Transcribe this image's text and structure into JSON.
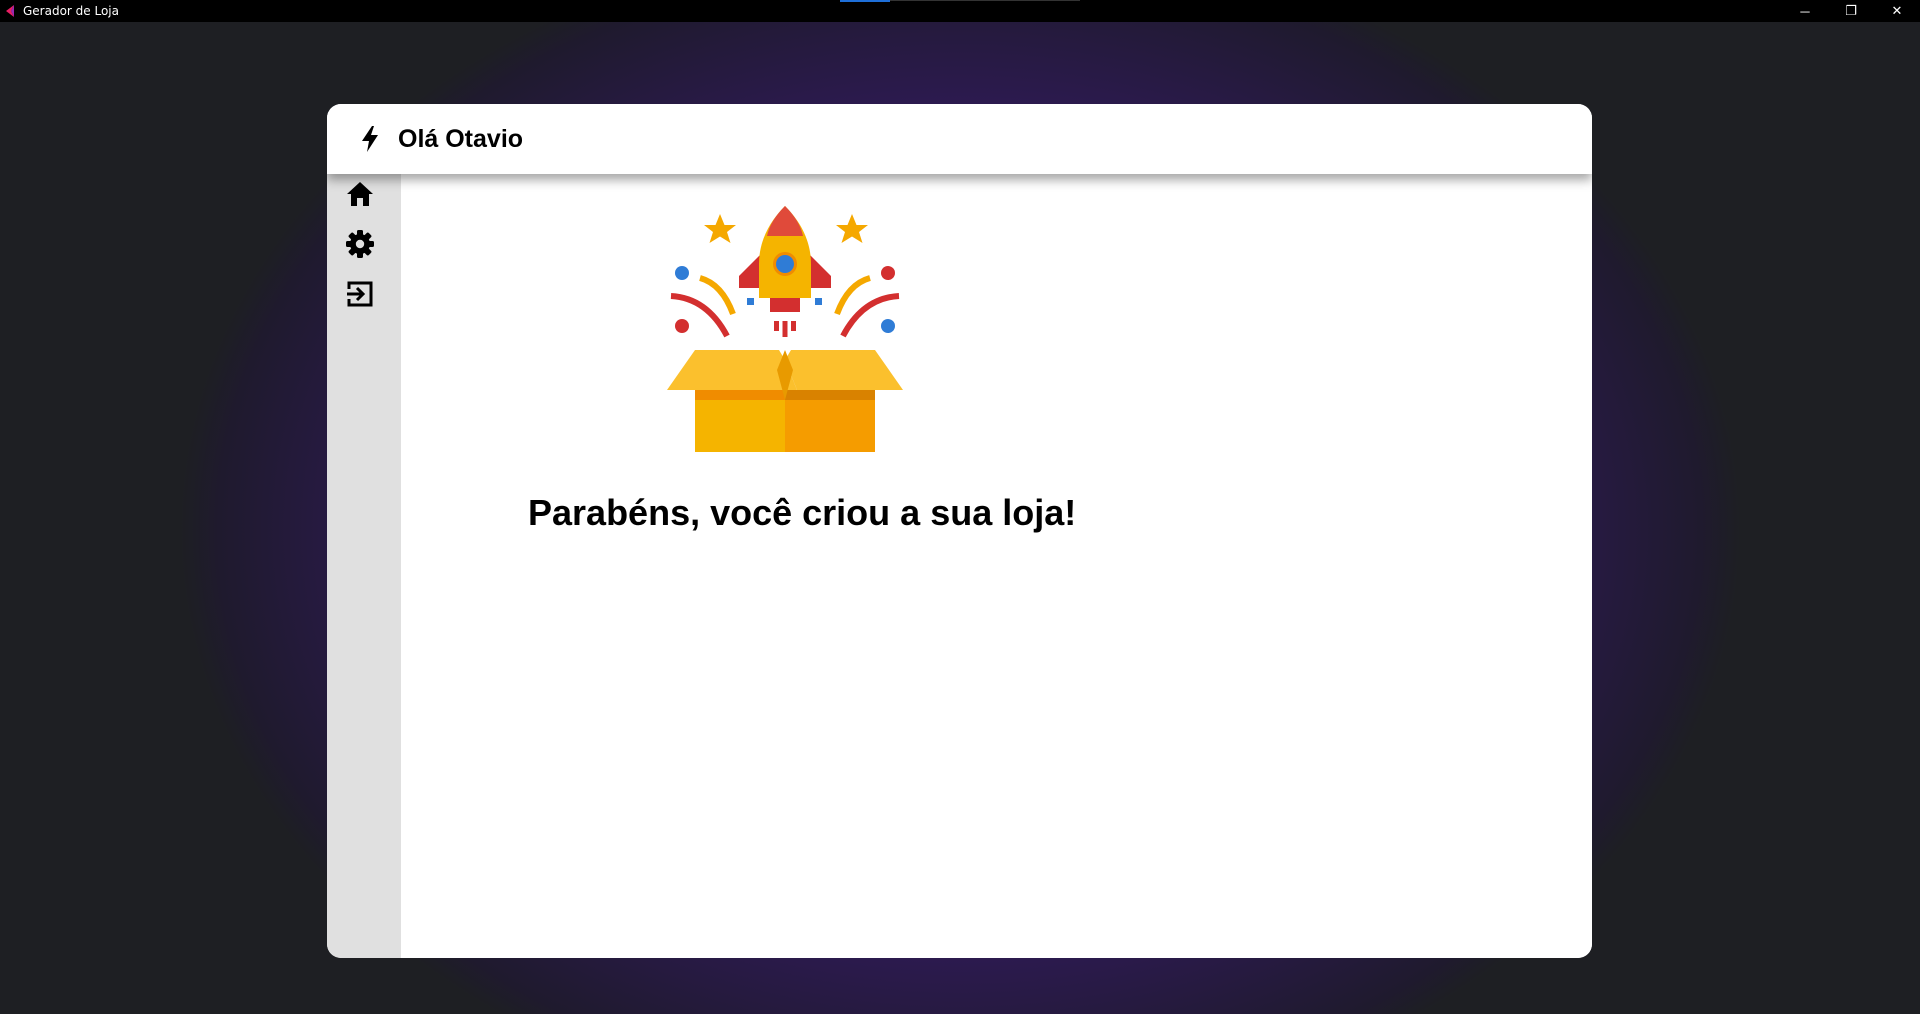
{
  "window": {
    "title": "Gerador de Loja",
    "controls": {
      "minimize": "─",
      "restore": "❐",
      "close": "✕"
    }
  },
  "header": {
    "icon": "bolt-icon",
    "greeting": "Olá Otavio"
  },
  "sidebar": {
    "items": [
      {
        "name": "home",
        "icon": "home-icon"
      },
      {
        "name": "settings",
        "icon": "gear-icon"
      },
      {
        "name": "logout",
        "icon": "logout-icon"
      }
    ]
  },
  "main": {
    "illustration": "rocket-gift-box-illustration",
    "headline": "Parabéns, você criou a sua loja!"
  },
  "colors": {
    "background_purple": "#3a1a73",
    "background_dark": "#1e1f23",
    "card": "#ffffff",
    "sidebar": "#e0e0e0",
    "titlebar": "#000000",
    "box_yellow": "#fbc02d",
    "box_orange": "#f59c00",
    "rocket_red": "#d32f2f",
    "accent_blue": "#2f7cd6"
  }
}
